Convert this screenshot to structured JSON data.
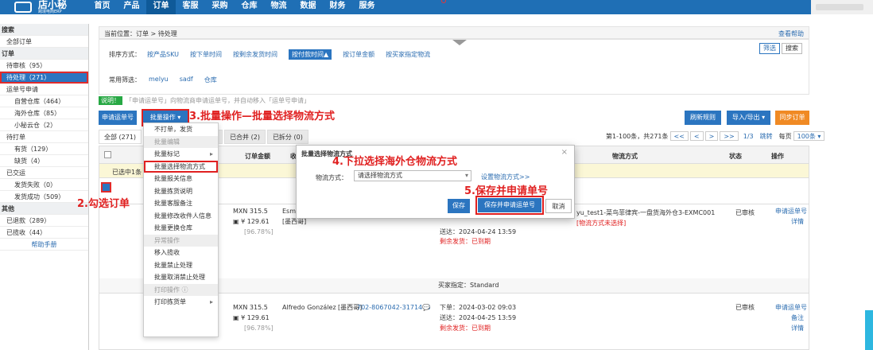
{
  "header": {
    "logo_title": "店小秘",
    "logo_sub": "跨境电商ERP",
    "nav": [
      "首页",
      "产品",
      "订单",
      "客服",
      "采购",
      "仓库",
      "物流",
      "数据",
      "财务",
      "服务"
    ],
    "active": "订单"
  },
  "sidebar": {
    "items": [
      {
        "label": "搜索",
        "type": "group"
      },
      {
        "label": "全部订单",
        "type": "sub"
      },
      {
        "label": "订单",
        "type": "group"
      },
      {
        "label": "待审核（95）",
        "type": "sub"
      },
      {
        "label": "待处理（271）",
        "type": "active"
      },
      {
        "label": "运单号申请",
        "type": "sub"
      },
      {
        "label": "自营仓库（464）",
        "type": "sub2"
      },
      {
        "label": "海外仓库（85）",
        "type": "sub2"
      },
      {
        "label": "小秘云仓（2）",
        "type": "sub2"
      },
      {
        "label": "待打单",
        "type": "sub"
      },
      {
        "label": "有货（129）",
        "type": "sub2"
      },
      {
        "label": "缺货（4）",
        "type": "sub2"
      },
      {
        "label": "已交运",
        "type": "sub"
      },
      {
        "label": "发货失败（0）",
        "type": "sub2"
      },
      {
        "label": "发货成功（509）",
        "type": "sub2"
      },
      {
        "label": "其他",
        "type": "group"
      },
      {
        "label": "已退款（289）",
        "type": "sub"
      },
      {
        "label": "已揽收（44）",
        "type": "sub"
      },
      {
        "label": "帮助手册",
        "type": "help"
      }
    ]
  },
  "breadcrumb": {
    "text": "当前位置：订单 > 待处理",
    "help": "查看帮助"
  },
  "sort": {
    "label": "排序方式：",
    "options": [
      "按产品SKU",
      "按下单时间",
      "按剩余发货时间",
      "按付款时间▲",
      "按订单金额",
      "按买家指定物流"
    ],
    "active": "按付款时间▲"
  },
  "common": {
    "label": "常用筛选：",
    "items": [
      "melyu",
      "sadf",
      "仓库"
    ]
  },
  "filter_buttons": {
    "filter": "筛选",
    "search": "搜索"
  },
  "tip": {
    "badge": "说明！",
    "text": "「申请运单号」向物流商申请运单号，并自动移入「运单号申请」"
  },
  "actions": {
    "apply": "申请运单号",
    "batch": "批量操作 ▾",
    "refresh": "刷新规则",
    "io": "导入/导出 ▾",
    "sync": "同步订单"
  },
  "annotations": {
    "a3": "3.批量操作—批量选择物流方式",
    "a2": "2.勾选订单",
    "a4": "4.下拉选择海外仓物流方式",
    "a5": "5.保存并申请单号"
  },
  "tabs": [
    "全部 (271)",
    "",
    "已合并 (2)",
    "已拆分 (0)"
  ],
  "pager": {
    "info": "第1-100条，共271条",
    "btns": [
      "<<",
      "<",
      ">",
      ">>"
    ],
    "page": "1/3",
    "jump": "跳转",
    "per": "每页",
    "per_val": "100条 ▾"
  },
  "table": {
    "headers": [
      "订单金额",
      "收",
      "物流方式",
      "状态",
      "操作"
    ],
    "selbar": "已选中1条",
    "row1": {
      "amount": "MXN 315.5",
      "sub": "¥ 129.61",
      "pct": "[96.78%]",
      "buyer": "Esme",
      "country": "[墨西哥]",
      "shipping": "yu_test1-菜鸟菲律宾-一盘货海外仓3-EXMC001",
      "ship_red": "[物流方式未选择]",
      "time1": "送达：2024-04-24 13:59",
      "time2": "剩余发货：已到期",
      "status": "已审核",
      "op1": "申请运单号",
      "op2": "详情"
    },
    "buyer_specified": "买家指定：Standard",
    "row2": {
      "amount": "MXN 315.5",
      "sub": "¥ 129.61",
      "pct": "[96.78%]",
      "buyer": "Alfredo González",
      "country": "[墨西哥]",
      "phone": "702-8067042-3171446",
      "time0": "下单：2024-03-02 09:03",
      "time1": "送达：2024-04-25 13:59",
      "time2": "剩余发货：已到期",
      "status": "已审核",
      "op1": "申请运单号",
      "op2": "备注",
      "op3": "详情"
    }
  },
  "menu": {
    "items": [
      {
        "label": "不打单，发货",
        "type": "item"
      },
      {
        "label": "批量编辑",
        "type": "hdr"
      },
      {
        "label": "批量标记",
        "type": "sub"
      },
      {
        "label": "批量选择物流方式",
        "type": "hl"
      },
      {
        "label": "批量报关信息",
        "type": "item"
      },
      {
        "label": "批量拣货说明",
        "type": "item"
      },
      {
        "label": "批量客服备注",
        "type": "item"
      },
      {
        "label": "批量修改收件人信息",
        "type": "item"
      },
      {
        "label": "批量更换仓库",
        "type": "item"
      },
      {
        "label": "异常操作",
        "type": "hdr"
      },
      {
        "label": "移入揽收",
        "type": "item"
      },
      {
        "label": "批量禁止处理",
        "type": "item"
      },
      {
        "label": "批量取消禁止处理",
        "type": "item"
      },
      {
        "label": "打印操作 ⓘ",
        "type": "hdr"
      },
      {
        "label": "打印拣货单",
        "type": "sub"
      }
    ]
  },
  "modal": {
    "title": "批量选择物流方式",
    "label": "物流方式：",
    "placeholder": "请选择物流方式",
    "settings": "设置物流方式>>",
    "save": "保存",
    "save_apply": "保存并申请运单号",
    "cancel": "取消"
  },
  "colors": {
    "primary": "#2b75c0",
    "topbar": "#1f6fb5",
    "annotation": "#e02020",
    "sync": "#f08a24"
  }
}
